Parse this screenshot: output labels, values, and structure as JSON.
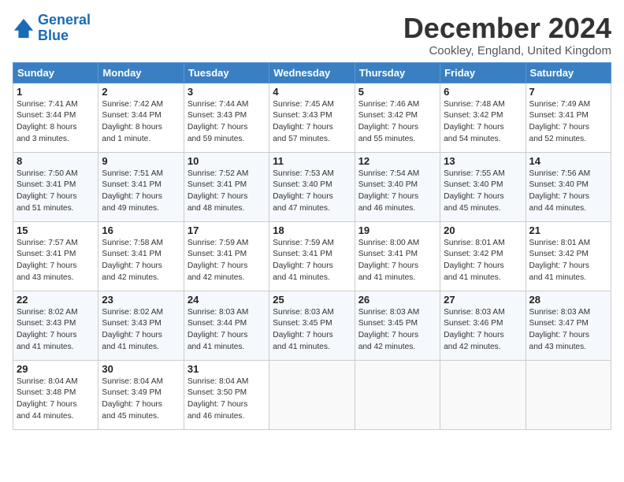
{
  "logo": {
    "line1": "General",
    "line2": "Blue"
  },
  "title": "December 2024",
  "location": "Cookley, England, United Kingdom",
  "days_header": [
    "Sunday",
    "Monday",
    "Tuesday",
    "Wednesday",
    "Thursday",
    "Friday",
    "Saturday"
  ],
  "weeks": [
    [
      {
        "day": "1",
        "info": "Sunrise: 7:41 AM\nSunset: 3:44 PM\nDaylight: 8 hours\nand 3 minutes."
      },
      {
        "day": "2",
        "info": "Sunrise: 7:42 AM\nSunset: 3:44 PM\nDaylight: 8 hours\nand 1 minute."
      },
      {
        "day": "3",
        "info": "Sunrise: 7:44 AM\nSunset: 3:43 PM\nDaylight: 7 hours\nand 59 minutes."
      },
      {
        "day": "4",
        "info": "Sunrise: 7:45 AM\nSunset: 3:43 PM\nDaylight: 7 hours\nand 57 minutes."
      },
      {
        "day": "5",
        "info": "Sunrise: 7:46 AM\nSunset: 3:42 PM\nDaylight: 7 hours\nand 55 minutes."
      },
      {
        "day": "6",
        "info": "Sunrise: 7:48 AM\nSunset: 3:42 PM\nDaylight: 7 hours\nand 54 minutes."
      },
      {
        "day": "7",
        "info": "Sunrise: 7:49 AM\nSunset: 3:41 PM\nDaylight: 7 hours\nand 52 minutes."
      }
    ],
    [
      {
        "day": "8",
        "info": "Sunrise: 7:50 AM\nSunset: 3:41 PM\nDaylight: 7 hours\nand 51 minutes."
      },
      {
        "day": "9",
        "info": "Sunrise: 7:51 AM\nSunset: 3:41 PM\nDaylight: 7 hours\nand 49 minutes."
      },
      {
        "day": "10",
        "info": "Sunrise: 7:52 AM\nSunset: 3:41 PM\nDaylight: 7 hours\nand 48 minutes."
      },
      {
        "day": "11",
        "info": "Sunrise: 7:53 AM\nSunset: 3:40 PM\nDaylight: 7 hours\nand 47 minutes."
      },
      {
        "day": "12",
        "info": "Sunrise: 7:54 AM\nSunset: 3:40 PM\nDaylight: 7 hours\nand 46 minutes."
      },
      {
        "day": "13",
        "info": "Sunrise: 7:55 AM\nSunset: 3:40 PM\nDaylight: 7 hours\nand 45 minutes."
      },
      {
        "day": "14",
        "info": "Sunrise: 7:56 AM\nSunset: 3:40 PM\nDaylight: 7 hours\nand 44 minutes."
      }
    ],
    [
      {
        "day": "15",
        "info": "Sunrise: 7:57 AM\nSunset: 3:41 PM\nDaylight: 7 hours\nand 43 minutes."
      },
      {
        "day": "16",
        "info": "Sunrise: 7:58 AM\nSunset: 3:41 PM\nDaylight: 7 hours\nand 42 minutes."
      },
      {
        "day": "17",
        "info": "Sunrise: 7:59 AM\nSunset: 3:41 PM\nDaylight: 7 hours\nand 42 minutes."
      },
      {
        "day": "18",
        "info": "Sunrise: 7:59 AM\nSunset: 3:41 PM\nDaylight: 7 hours\nand 41 minutes."
      },
      {
        "day": "19",
        "info": "Sunrise: 8:00 AM\nSunset: 3:41 PM\nDaylight: 7 hours\nand 41 minutes."
      },
      {
        "day": "20",
        "info": "Sunrise: 8:01 AM\nSunset: 3:42 PM\nDaylight: 7 hours\nand 41 minutes."
      },
      {
        "day": "21",
        "info": "Sunrise: 8:01 AM\nSunset: 3:42 PM\nDaylight: 7 hours\nand 41 minutes."
      }
    ],
    [
      {
        "day": "22",
        "info": "Sunrise: 8:02 AM\nSunset: 3:43 PM\nDaylight: 7 hours\nand 41 minutes."
      },
      {
        "day": "23",
        "info": "Sunrise: 8:02 AM\nSunset: 3:43 PM\nDaylight: 7 hours\nand 41 minutes."
      },
      {
        "day": "24",
        "info": "Sunrise: 8:03 AM\nSunset: 3:44 PM\nDaylight: 7 hours\nand 41 minutes."
      },
      {
        "day": "25",
        "info": "Sunrise: 8:03 AM\nSunset: 3:45 PM\nDaylight: 7 hours\nand 41 minutes."
      },
      {
        "day": "26",
        "info": "Sunrise: 8:03 AM\nSunset: 3:45 PM\nDaylight: 7 hours\nand 42 minutes."
      },
      {
        "day": "27",
        "info": "Sunrise: 8:03 AM\nSunset: 3:46 PM\nDaylight: 7 hours\nand 42 minutes."
      },
      {
        "day": "28",
        "info": "Sunrise: 8:03 AM\nSunset: 3:47 PM\nDaylight: 7 hours\nand 43 minutes."
      }
    ],
    [
      {
        "day": "29",
        "info": "Sunrise: 8:04 AM\nSunset: 3:48 PM\nDaylight: 7 hours\nand 44 minutes."
      },
      {
        "day": "30",
        "info": "Sunrise: 8:04 AM\nSunset: 3:49 PM\nDaylight: 7 hours\nand 45 minutes."
      },
      {
        "day": "31",
        "info": "Sunrise: 8:04 AM\nSunset: 3:50 PM\nDaylight: 7 hours\nand 46 minutes."
      },
      {
        "day": "",
        "info": ""
      },
      {
        "day": "",
        "info": ""
      },
      {
        "day": "",
        "info": ""
      },
      {
        "day": "",
        "info": ""
      }
    ]
  ]
}
